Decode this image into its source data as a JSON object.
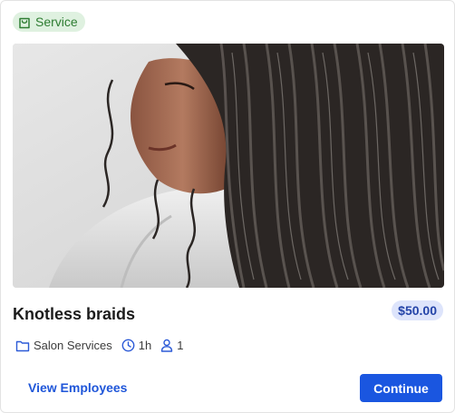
{
  "badge": {
    "label": "Service",
    "icon": "shopping-bag-icon",
    "text_color": "#2e7d32",
    "bg_color": "#dff1e0"
  },
  "image": {
    "icon": "photo-braids",
    "alt": "Knotless braids"
  },
  "service": {
    "title": "Knotless braids",
    "price": "$50.00",
    "price_text_color": "#2444a8",
    "price_bg_color": "#dde4fb"
  },
  "meta": {
    "category": "Salon Services",
    "category_icon": "folder-icon",
    "duration": "1h",
    "duration_icon": "clock-icon",
    "capacity": "1",
    "capacity_icon": "person-icon",
    "icon_color": "#2d5bd7"
  },
  "actions": {
    "view_employees_label": "View Employees",
    "continue_label": "Continue",
    "link_color": "#1f56d9",
    "button_color": "#1a56e0"
  }
}
